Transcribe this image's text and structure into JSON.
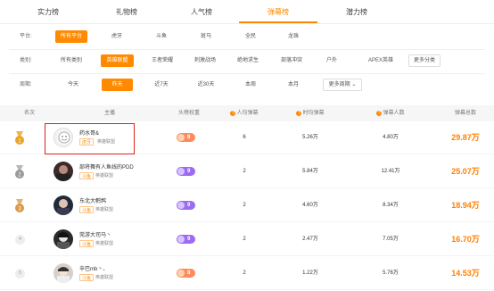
{
  "tabs": [
    {
      "label": "实力榜"
    },
    {
      "label": "礼物榜"
    },
    {
      "label": "人气榜"
    },
    {
      "label": "弹幕榜"
    },
    {
      "label": "潜力榜"
    }
  ],
  "filters": {
    "platform": {
      "label": "平台:",
      "options": [
        "所有平台",
        "虎牙",
        "斗鱼",
        "斑马",
        "全民",
        "龙珠"
      ]
    },
    "category": {
      "label": "类别:",
      "options": [
        "所有类别",
        "英雄联盟",
        "王者荣耀",
        "刺激战场",
        "绝地求生",
        "部落冲突",
        "户外",
        "APEX英雄"
      ],
      "more": "更多分类"
    },
    "period": {
      "label": "周期:",
      "options": [
        "今天",
        "昨天",
        "近7天",
        "近30天",
        "本周",
        "本月"
      ],
      "more": "更多周期"
    }
  },
  "table": {
    "headers": {
      "rank": "名次",
      "anchor": "主播",
      "weight": "头榜权重",
      "people_danmu": "人均弹幕",
      "time_danmu": "时均弹幕",
      "danmu_people": "弹幕人数",
      "total": "弹幕总数"
    },
    "rows": [
      {
        "rank": "1",
        "name": "药水哥&",
        "platform": "虎牙",
        "category": "英雄联盟",
        "weight": "8",
        "people_danmu": "6",
        "time_danmu": "5.26万",
        "danmu_people": "4.80万",
        "total": "29.87万"
      },
      {
        "rank": "2",
        "name": "部将舞有人鱼线的PDD",
        "platform": "斗鱼",
        "category": "英雄联盟",
        "weight": "9",
        "people_danmu": "2",
        "time_danmu": "5.84万",
        "danmu_people": "12.41万",
        "total": "25.07万"
      },
      {
        "rank": "3",
        "name": "东北大鹌鹑",
        "platform": "斗鱼",
        "category": "英雄联盟",
        "weight": "9",
        "people_danmu": "2",
        "time_danmu": "4.60万",
        "danmu_people": "8.34万",
        "total": "18.94万"
      },
      {
        "rank": "4",
        "name": "莞游大司马丶",
        "platform": "斗鱼",
        "category": "英雄联盟",
        "weight": "9",
        "people_danmu": "2",
        "time_danmu": "2.47万",
        "danmu_people": "7.05万",
        "total": "16.70万"
      },
      {
        "rank": "5",
        "name": "辛巴mb丶、",
        "platform": "斗鱼",
        "category": "英雄联盟",
        "weight": "8",
        "people_danmu": "2",
        "time_danmu": "1.22万",
        "danmu_people": "5.76万",
        "total": "14.53万"
      }
    ]
  },
  "colors": {
    "accent": "#ff8a00",
    "highlight_box": "#e02020",
    "gold": "#e0a020",
    "silver": "#9a9a9a",
    "bronze": "#d89a4a"
  }
}
